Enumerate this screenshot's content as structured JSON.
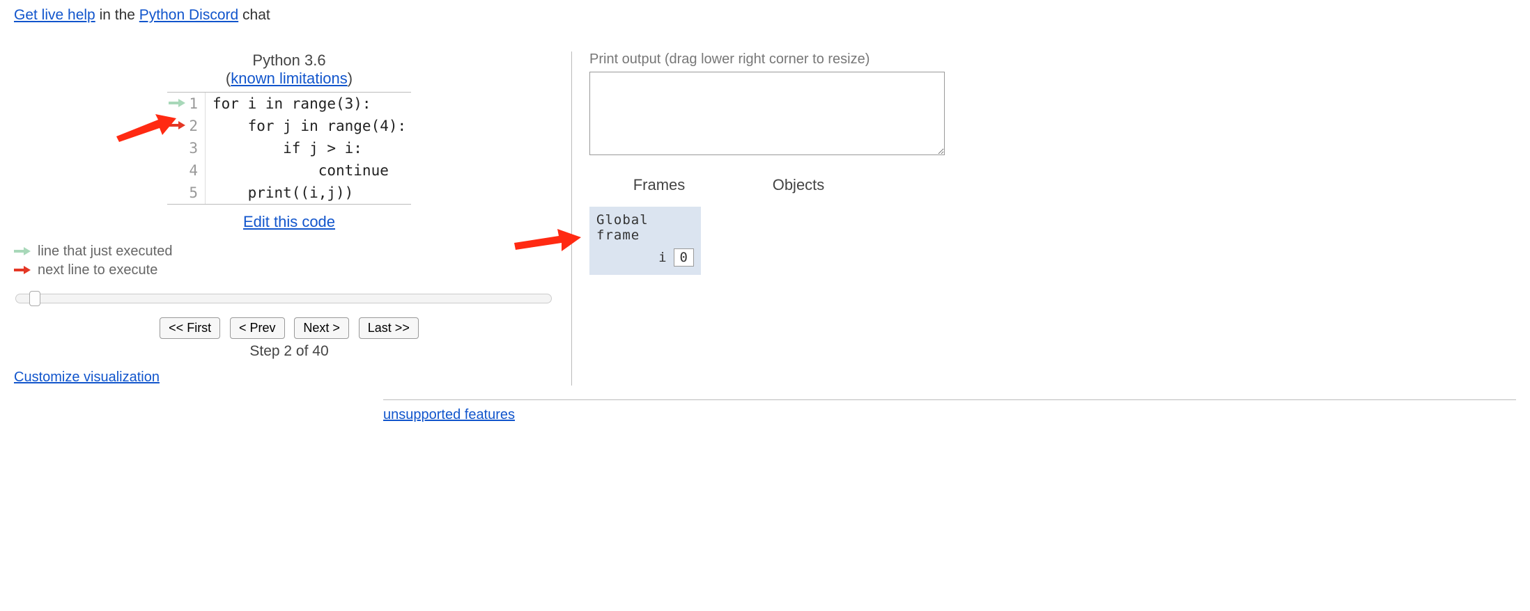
{
  "help": {
    "live_help": "Get live help",
    "mid": " in the ",
    "discord": "Python Discord",
    "tail": " chat"
  },
  "header": {
    "lang": "Python 3.6",
    "paren_open": "(",
    "known_limitations": "known limitations",
    "paren_close": ")"
  },
  "code": {
    "lines": [
      {
        "n": "1",
        "text": "for i in range(3):"
      },
      {
        "n": "2",
        "text": "    for j in range(4):"
      },
      {
        "n": "3",
        "text": "        if j > i:"
      },
      {
        "n": "4",
        "text": "            continue"
      },
      {
        "n": "5",
        "text": "    print((i,j))"
      }
    ],
    "prev_line_index": 0,
    "cur_line_index": 1
  },
  "edit_code": "Edit this code",
  "legend": {
    "prev": "line that just executed",
    "next": "next line to execute"
  },
  "vcr": {
    "first": "<< First",
    "prev": "< Prev",
    "next": "Next >",
    "last": "Last >>"
  },
  "step": {
    "prefix": "Step ",
    "cur": "2",
    "of": " of ",
    "total": "40"
  },
  "customize": "Customize visualization",
  "output": {
    "label": "Print output (drag lower right corner to resize)",
    "value": ""
  },
  "heap": {
    "frames_hdr": "Frames",
    "objects_hdr": "Objects"
  },
  "frame": {
    "title": "Global frame",
    "vars": [
      {
        "name": "i",
        "val": "0"
      }
    ]
  },
  "footer": {
    "unsupported": "unsupported features"
  },
  "colors": {
    "prev_arrow": "#a8d8b9",
    "cur_arrow": "#e43725",
    "annotation": "#ff2a12"
  }
}
